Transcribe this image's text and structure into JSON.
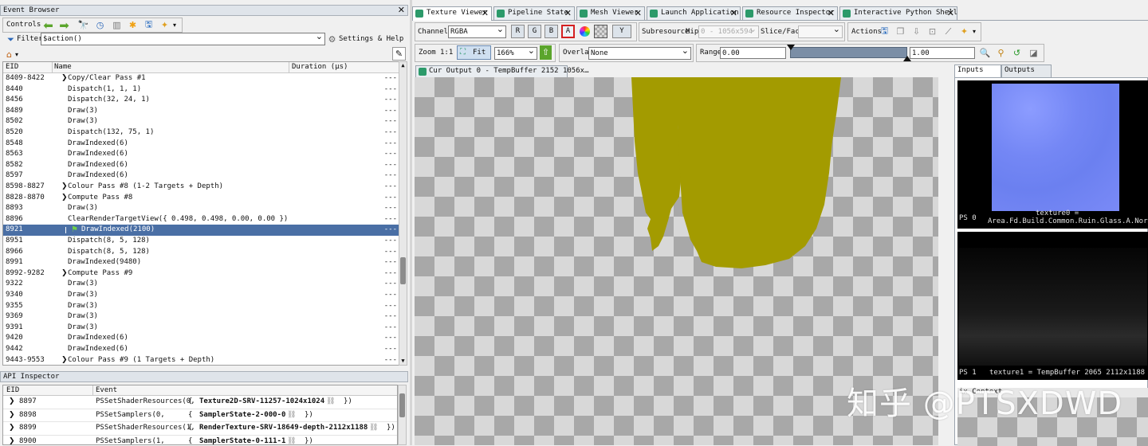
{
  "event_browser": {
    "title": "Event Browser",
    "controls_label": "Controls",
    "filter_label": "Filter",
    "filter_value": "$action()",
    "settings_label": "Settings & Help",
    "columns": [
      "EID",
      "Name",
      "Duration (µs)"
    ],
    "rows": [
      {
        "eid": "8409-8422",
        "name": "Copy/Clear Pass #1",
        "dur": "---",
        "expander": true,
        "indent": 0
      },
      {
        "eid": "8440",
        "name": "Dispatch(1, 1, 1)",
        "dur": "---",
        "indent": 1
      },
      {
        "eid": "8456",
        "name": "Dispatch(32, 24, 1)",
        "dur": "---",
        "indent": 1
      },
      {
        "eid": "8489",
        "name": "Draw(3)",
        "dur": "---",
        "indent": 1
      },
      {
        "eid": "8502",
        "name": "Draw(3)",
        "dur": "---",
        "indent": 1
      },
      {
        "eid": "8520",
        "name": "Dispatch(132, 75, 1)",
        "dur": "---",
        "indent": 1
      },
      {
        "eid": "8548",
        "name": "DrawIndexed(6)",
        "dur": "---",
        "indent": 1
      },
      {
        "eid": "8563",
        "name": "DrawIndexed(6)",
        "dur": "---",
        "indent": 1
      },
      {
        "eid": "8582",
        "name": "DrawIndexed(6)",
        "dur": "---",
        "indent": 1
      },
      {
        "eid": "8597",
        "name": "DrawIndexed(6)",
        "dur": "---",
        "indent": 1
      },
      {
        "eid": "8598-8827",
        "name": "Colour Pass #8 (1-2 Targets + Depth)",
        "dur": "---",
        "expander": true,
        "indent": 0
      },
      {
        "eid": "8828-8870",
        "name": "Compute Pass #8",
        "dur": "---",
        "expander": true,
        "indent": 0
      },
      {
        "eid": "8893",
        "name": "Draw(3)",
        "dur": "---",
        "indent": 1
      },
      {
        "eid": "8896",
        "name": "ClearRenderTargetView({ 0.498, 0.498, 0.00, 0.00 })",
        "dur": "---",
        "indent": 1
      },
      {
        "eid": "8921",
        "name": "DrawIndexed(2100)",
        "dur": "---",
        "indent": 1,
        "selected": true
      },
      {
        "eid": "8951",
        "name": "Dispatch(8, 5, 128)",
        "dur": "---",
        "indent": 1
      },
      {
        "eid": "8966",
        "name": "Dispatch(8, 5, 128)",
        "dur": "---",
        "indent": 1
      },
      {
        "eid": "8991",
        "name": "DrawIndexed(9480)",
        "dur": "---",
        "indent": 1
      },
      {
        "eid": "8992-9282",
        "name": "Compute Pass #9",
        "dur": "---",
        "expander": true,
        "indent": 0
      },
      {
        "eid": "9322",
        "name": "Draw(3)",
        "dur": "---",
        "indent": 1
      },
      {
        "eid": "9340",
        "name": "Draw(3)",
        "dur": "---",
        "indent": 1
      },
      {
        "eid": "9355",
        "name": "Draw(3)",
        "dur": "---",
        "indent": 1
      },
      {
        "eid": "9369",
        "name": "Draw(3)",
        "dur": "---",
        "indent": 1
      },
      {
        "eid": "9391",
        "name": "Draw(3)",
        "dur": "---",
        "indent": 1
      },
      {
        "eid": "9420",
        "name": "DrawIndexed(6)",
        "dur": "---",
        "indent": 1
      },
      {
        "eid": "9442",
        "name": "DrawIndexed(6)",
        "dur": "---",
        "indent": 1
      },
      {
        "eid": "9443-9553",
        "name": "Colour Pass #9 (1 Targets + Depth)",
        "dur": "---",
        "expander": true,
        "indent": 0
      }
    ]
  },
  "api_inspector": {
    "title": "API Inspector",
    "columns": [
      "EID",
      "Event"
    ],
    "rows": [
      {
        "eid": "8897",
        "fn": "PSSetShaderResources(0,",
        "mid": "{",
        "res": "Texture2D-SRV-11257-1024x1024",
        "end": "})"
      },
      {
        "eid": "8898",
        "fn": "PSSetSamplers(0,",
        "mid": "{",
        "res": "SamplerState-2-000-0",
        "end": "})"
      },
      {
        "eid": "8899",
        "fn": "PSSetShaderResources(1,",
        "mid": "{",
        "res": "RenderTexture-SRV-18649-depth-2112x1188",
        "end": "})"
      },
      {
        "eid": "8900",
        "fn": "PSSetSamplers(1,",
        "mid": "{",
        "res": "SamplerState-0-111-1",
        "end": "})"
      }
    ]
  },
  "tabs": [
    {
      "label": "Texture Viewer",
      "active": true
    },
    {
      "label": "Pipeline State"
    },
    {
      "label": "Mesh Viewer"
    },
    {
      "label": "Launch Application"
    },
    {
      "label": "Resource Inspector"
    },
    {
      "label": "Interactive Python Shell"
    }
  ],
  "toolbar": {
    "channels_label": "Channels",
    "channels_value": "RGBA",
    "channel_buttons": [
      "R",
      "G",
      "B",
      "A"
    ],
    "y_button": "Y",
    "subresource_label": "Subresource",
    "mip_label": "Mip",
    "mip_value": "0 - 1056x594",
    "slice_label": "Slice/Face",
    "slice_value": "",
    "actions_label": "Actions",
    "zoom_label": "Zoom",
    "zoom_1to1": "1:1",
    "fit_label": "Fit",
    "zoom_value": "166%",
    "overlay_label": "Overlay",
    "overlay_value": "None",
    "range_label": "Range",
    "range_min": "0.00",
    "range_max": "1.00"
  },
  "viewer": {
    "tab_label": "Cur Output 0 - TempBuffer 2152 1056x…",
    "mesh_color": "#a39b00"
  },
  "side_panel": {
    "tabs": [
      "Inputs",
      "Outputs"
    ],
    "thumb1_ps": "PS 0",
    "thumb1_caption_a": "texture0 =",
    "thumb1_caption_b": "Area.Fd.Build.Common.Ruin.Glass.A.Normal",
    "thumb2_ps": "PS 1",
    "thumb2_caption": "texture1 = TempBuffer 2065 2112x1188",
    "context_label": "ix Context"
  },
  "watermark": "知乎 @PTSXDWD"
}
